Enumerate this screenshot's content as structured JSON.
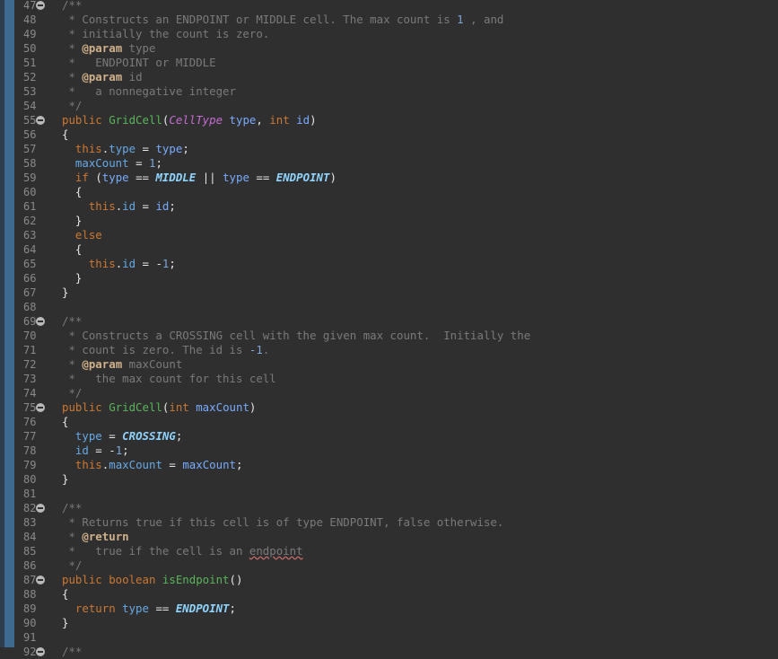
{
  "editor": {
    "lines": [
      {
        "n": "47",
        "fold": true,
        "tokens": [
          {
            "t": "/**",
            "c": "comment"
          }
        ]
      },
      {
        "n": "48",
        "fold": false,
        "tokens": [
          {
            "t": " * Constructs an ENDPOINT or MIDDLE cell. The max count is ",
            "c": "comment"
          },
          {
            "t": "1",
            "c": "number"
          },
          {
            "t": " , and",
            "c": "comment"
          }
        ]
      },
      {
        "n": "49",
        "fold": false,
        "tokens": [
          {
            "t": " * initially the count is zero.",
            "c": "comment"
          }
        ]
      },
      {
        "n": "50",
        "fold": false,
        "tokens": [
          {
            "t": " * ",
            "c": "comment"
          },
          {
            "t": "@param",
            "c": "doctag"
          },
          {
            "t": " type",
            "c": "comment"
          }
        ]
      },
      {
        "n": "51",
        "fold": false,
        "tokens": [
          {
            "t": " *   ENDPOINT or MIDDLE",
            "c": "comment"
          }
        ]
      },
      {
        "n": "52",
        "fold": false,
        "tokens": [
          {
            "t": " * ",
            "c": "comment"
          },
          {
            "t": "@param",
            "c": "doctag"
          },
          {
            "t": " id",
            "c": "comment"
          }
        ]
      },
      {
        "n": "53",
        "fold": false,
        "tokens": [
          {
            "t": " *   a nonnegative integer",
            "c": "comment"
          }
        ]
      },
      {
        "n": "54",
        "fold": false,
        "tokens": [
          {
            "t": " */",
            "c": "comment"
          }
        ]
      },
      {
        "n": "55",
        "fold": true,
        "tokens": [
          {
            "t": "public ",
            "c": "keyword"
          },
          {
            "t": "GridCell",
            "c": "class"
          },
          {
            "t": "(",
            "c": "bracket"
          },
          {
            "t": "CellType",
            "c": "italic"
          },
          {
            "t": " type",
            "c": "param"
          },
          {
            "t": ", ",
            "c": "op"
          },
          {
            "t": "int",
            "c": "type"
          },
          {
            "t": " id",
            "c": "param"
          },
          {
            "t": ")",
            "c": "bracket"
          }
        ]
      },
      {
        "n": "56",
        "fold": false,
        "tokens": [
          {
            "t": "{",
            "c": "bracket"
          }
        ]
      },
      {
        "n": "57",
        "fold": false,
        "tokens": [
          {
            "t": "  this",
            "c": "keyword"
          },
          {
            "t": ".",
            "c": "op"
          },
          {
            "t": "type",
            "c": "field"
          },
          {
            "t": " = ",
            "c": "op"
          },
          {
            "t": "type",
            "c": "param"
          },
          {
            "t": ";",
            "c": "op"
          }
        ]
      },
      {
        "n": "58",
        "fold": false,
        "tokens": [
          {
            "t": "  maxCount",
            "c": "field"
          },
          {
            "t": " = ",
            "c": "op"
          },
          {
            "t": "1",
            "c": "number"
          },
          {
            "t": ";",
            "c": "op"
          }
        ]
      },
      {
        "n": "59",
        "fold": false,
        "tokens": [
          {
            "t": "  if ",
            "c": "keyword"
          },
          {
            "t": "(",
            "c": "bracket"
          },
          {
            "t": "type",
            "c": "param"
          },
          {
            "t": " == ",
            "c": "op"
          },
          {
            "t": "MIDDLE",
            "c": "const"
          },
          {
            "t": " || ",
            "c": "op"
          },
          {
            "t": "type",
            "c": "param"
          },
          {
            "t": " == ",
            "c": "op"
          },
          {
            "t": "ENDPOINT",
            "c": "const"
          },
          {
            "t": ")",
            "c": "bracket"
          }
        ]
      },
      {
        "n": "60",
        "fold": false,
        "tokens": [
          {
            "t": "  {",
            "c": "bracket"
          }
        ]
      },
      {
        "n": "61",
        "fold": false,
        "tokens": [
          {
            "t": "    this",
            "c": "keyword"
          },
          {
            "t": ".",
            "c": "op"
          },
          {
            "t": "id",
            "c": "field"
          },
          {
            "t": " = ",
            "c": "op"
          },
          {
            "t": "id",
            "c": "param"
          },
          {
            "t": ";",
            "c": "op"
          }
        ]
      },
      {
        "n": "62",
        "fold": false,
        "tokens": [
          {
            "t": "  }",
            "c": "bracket"
          }
        ]
      },
      {
        "n": "63",
        "fold": false,
        "tokens": [
          {
            "t": "  else",
            "c": "keyword"
          }
        ]
      },
      {
        "n": "64",
        "fold": false,
        "tokens": [
          {
            "t": "  {",
            "c": "bracket"
          }
        ]
      },
      {
        "n": "65",
        "fold": false,
        "tokens": [
          {
            "t": "    this",
            "c": "keyword"
          },
          {
            "t": ".",
            "c": "op"
          },
          {
            "t": "id",
            "c": "field"
          },
          {
            "t": " = -",
            "c": "op"
          },
          {
            "t": "1",
            "c": "number"
          },
          {
            "t": ";",
            "c": "op"
          }
        ]
      },
      {
        "n": "66",
        "fold": false,
        "tokens": [
          {
            "t": "  }",
            "c": "bracket"
          }
        ]
      },
      {
        "n": "67",
        "fold": false,
        "tokens": [
          {
            "t": "}",
            "c": "bracket"
          }
        ]
      },
      {
        "n": "68",
        "fold": false,
        "tokens": []
      },
      {
        "n": "69",
        "fold": true,
        "tokens": [
          {
            "t": "/**",
            "c": "comment"
          }
        ]
      },
      {
        "n": "70",
        "fold": false,
        "tokens": [
          {
            "t": " * Constructs a CROSSING cell with the given max count.  Initially the",
            "c": "comment"
          }
        ]
      },
      {
        "n": "71",
        "fold": false,
        "tokens": [
          {
            "t": " * count is zero. The id is ",
            "c": "comment"
          },
          {
            "t": "-1",
            "c": "number"
          },
          {
            "t": ".",
            "c": "comment"
          }
        ]
      },
      {
        "n": "72",
        "fold": false,
        "tokens": [
          {
            "t": " * ",
            "c": "comment"
          },
          {
            "t": "@param",
            "c": "doctag"
          },
          {
            "t": " maxCount",
            "c": "comment"
          }
        ]
      },
      {
        "n": "73",
        "fold": false,
        "tokens": [
          {
            "t": " *   the max count for this cell",
            "c": "comment"
          }
        ]
      },
      {
        "n": "74",
        "fold": false,
        "tokens": [
          {
            "t": " */",
            "c": "comment"
          }
        ]
      },
      {
        "n": "75",
        "fold": true,
        "tokens": [
          {
            "t": "public ",
            "c": "keyword"
          },
          {
            "t": "GridCell",
            "c": "class"
          },
          {
            "t": "(",
            "c": "bracket"
          },
          {
            "t": "int",
            "c": "type"
          },
          {
            "t": " maxCount",
            "c": "param"
          },
          {
            "t": ")",
            "c": "bracket"
          }
        ]
      },
      {
        "n": "76",
        "fold": false,
        "tokens": [
          {
            "t": "{",
            "c": "bracket"
          }
        ]
      },
      {
        "n": "77",
        "fold": false,
        "tokens": [
          {
            "t": "  type",
            "c": "field"
          },
          {
            "t": " = ",
            "c": "op"
          },
          {
            "t": "CROSSING",
            "c": "const"
          },
          {
            "t": ";",
            "c": "op"
          }
        ]
      },
      {
        "n": "78",
        "fold": false,
        "tokens": [
          {
            "t": "  id",
            "c": "field"
          },
          {
            "t": " = -",
            "c": "op"
          },
          {
            "t": "1",
            "c": "number"
          },
          {
            "t": ";",
            "c": "op"
          }
        ]
      },
      {
        "n": "79",
        "fold": false,
        "tokens": [
          {
            "t": "  this",
            "c": "keyword"
          },
          {
            "t": ".",
            "c": "op"
          },
          {
            "t": "maxCount",
            "c": "field"
          },
          {
            "t": " = ",
            "c": "op"
          },
          {
            "t": "maxCount",
            "c": "param"
          },
          {
            "t": ";",
            "c": "op"
          }
        ]
      },
      {
        "n": "80",
        "fold": false,
        "tokens": [
          {
            "t": "}",
            "c": "bracket"
          }
        ]
      },
      {
        "n": "81",
        "fold": false,
        "tokens": []
      },
      {
        "n": "82",
        "fold": true,
        "tokens": [
          {
            "t": "/**",
            "c": "comment"
          }
        ]
      },
      {
        "n": "83",
        "fold": false,
        "tokens": [
          {
            "t": " * Returns true if this cell is of type ENDPOINT, false otherwise.",
            "c": "comment"
          }
        ]
      },
      {
        "n": "84",
        "fold": false,
        "tokens": [
          {
            "t": " * ",
            "c": "comment"
          },
          {
            "t": "@return",
            "c": "doctag"
          }
        ]
      },
      {
        "n": "85",
        "fold": false,
        "tokens": [
          {
            "t": " *   true if the cell is an ",
            "c": "comment"
          },
          {
            "t": "endpoint",
            "c": "link"
          }
        ]
      },
      {
        "n": "86",
        "fold": false,
        "tokens": [
          {
            "t": " */",
            "c": "comment"
          }
        ]
      },
      {
        "n": "87",
        "fold": true,
        "tokens": [
          {
            "t": "public ",
            "c": "keyword"
          },
          {
            "t": "boolean ",
            "c": "type"
          },
          {
            "t": "isEndpoint",
            "c": "method"
          },
          {
            "t": "()",
            "c": "bracket"
          }
        ]
      },
      {
        "n": "88",
        "fold": false,
        "tokens": [
          {
            "t": "{",
            "c": "bracket"
          }
        ]
      },
      {
        "n": "89",
        "fold": false,
        "tokens": [
          {
            "t": "  return ",
            "c": "keyword"
          },
          {
            "t": "type",
            "c": "field"
          },
          {
            "t": " == ",
            "c": "op"
          },
          {
            "t": "ENDPOINT",
            "c": "const"
          },
          {
            "t": ";",
            "c": "op"
          }
        ]
      },
      {
        "n": "90",
        "fold": false,
        "tokens": [
          {
            "t": "}",
            "c": "bracket"
          }
        ]
      },
      {
        "n": "91",
        "fold": false,
        "tokens": []
      },
      {
        "n": "92",
        "fold": true,
        "tokens": [
          {
            "t": "/**",
            "c": "comment"
          }
        ]
      }
    ]
  }
}
